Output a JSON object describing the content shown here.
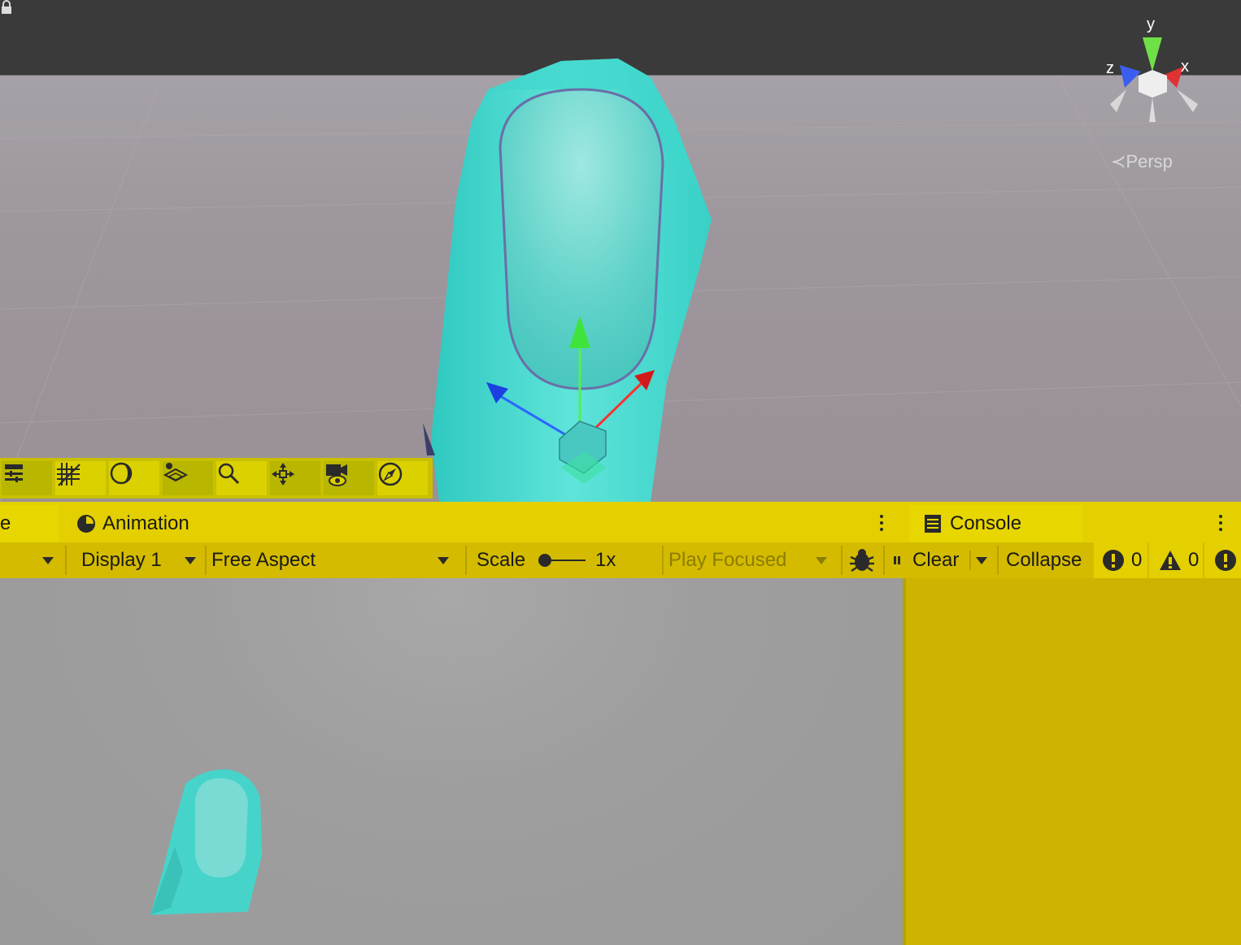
{
  "scene": {
    "projection_label": "Persp",
    "gizmo_axes": {
      "y": "y",
      "x": "x",
      "z": "z"
    },
    "overlay_tools": [
      {
        "icon": "tool-settings-icon"
      },
      {
        "icon": "grid-snapping-icon"
      },
      {
        "icon": "shading-mode-icon"
      },
      {
        "icon": "layers-icon"
      },
      {
        "icon": "search-icon"
      },
      {
        "icon": "move-tool-icon"
      },
      {
        "icon": "camera-visibility-icon"
      },
      {
        "icon": "compass-icon"
      }
    ]
  },
  "tabs": {
    "left_partial": "e",
    "animation": "Animation",
    "console": "Console"
  },
  "game_toolbar": {
    "display": "Display 1",
    "aspect": "Free Aspect",
    "scale_label": "Scale",
    "scale_value": "1x",
    "scale_level": 0.0,
    "play_mode": "Play Focused"
  },
  "console_toolbar": {
    "clear": "Clear",
    "collapse": "Collapse",
    "error_count": "0",
    "warning_count": "0"
  },
  "colors": {
    "highlight_yellow": "#e4cf00",
    "object_cyan": "#3fd6cc"
  }
}
